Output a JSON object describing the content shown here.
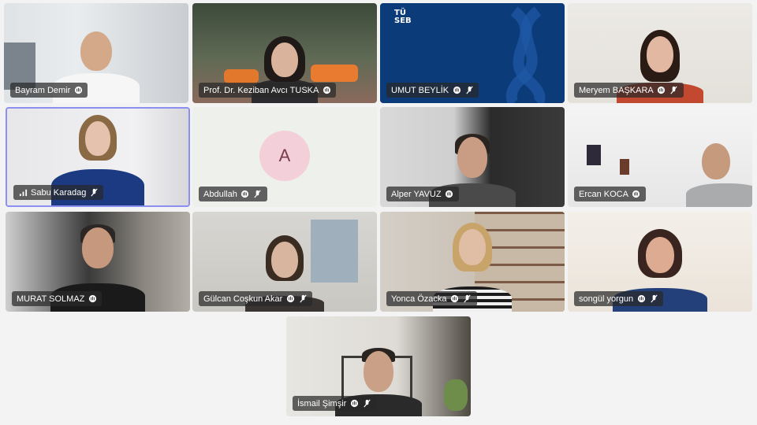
{
  "meeting": {
    "participants": [
      {
        "name": "Bayram Demir",
        "indicator": "hand-icon",
        "muted": false
      },
      {
        "name": "Prof. Dr. Keziban Avcı TUSKA",
        "indicator": "hand-icon",
        "muted": false
      },
      {
        "name": "UMUT BEYLİK",
        "indicator": "hand-icon",
        "muted": true
      },
      {
        "name": "Meryem BAŞKARA",
        "indicator": "hand-icon",
        "muted": true
      },
      {
        "name": "Sabu Karadag",
        "indicator": "signal-bars-icon",
        "muted": true
      },
      {
        "name": "Abdullah",
        "indicator": "hand-icon",
        "muted": true,
        "avatar_initial": "A"
      },
      {
        "name": "Alper YAVUZ",
        "indicator": "hand-icon",
        "muted": false
      },
      {
        "name": "Ercan KOCA",
        "indicator": "hand-icon",
        "muted": false
      },
      {
        "name": "MURAT SOLMAZ",
        "indicator": "hand-icon",
        "muted": false
      },
      {
        "name": "Gülcan Coşkun Akar",
        "indicator": "hand-icon",
        "muted": true
      },
      {
        "name": "Yonca Özacka",
        "indicator": "hand-icon",
        "muted": true
      },
      {
        "name": "songül yorgun",
        "indicator": "hand-icon",
        "muted": true
      },
      {
        "name": "İsmail Şimşir",
        "indicator": "hand-icon",
        "muted": true
      }
    ],
    "logo_text": [
      "TÜ",
      "SEB"
    ],
    "colors": {
      "tag_bg": "#282828",
      "avatar_bg": "#f3cfd9",
      "brand_blue": "#0b3b78",
      "speaker_border": "#8a8ff0"
    }
  }
}
